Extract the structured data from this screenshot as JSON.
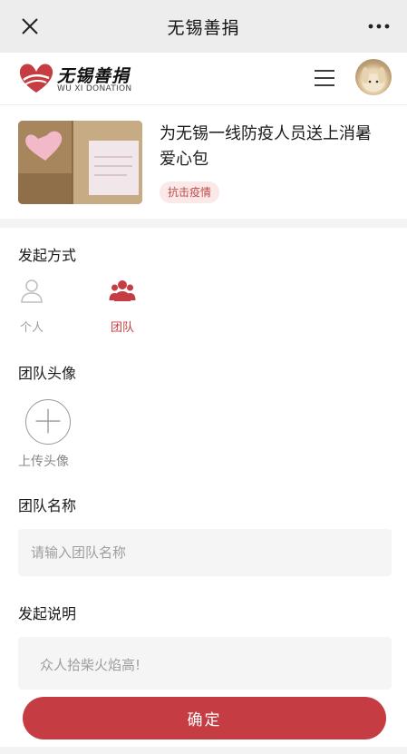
{
  "window": {
    "title": "无锡善捐",
    "close_icon": "close-icon",
    "more_icon": "more-dots-icon"
  },
  "brand": {
    "name_cn": "无锡善捐",
    "name_en": "WU XI DONATION",
    "accent": "#c53d43"
  },
  "project": {
    "title": "为无锡一线防疫人员送上消暑爱心包",
    "tag": "抗击疫情"
  },
  "initiate": {
    "label": "发起方式",
    "options": [
      {
        "label": "个人",
        "icon": "person-icon",
        "selected": false
      },
      {
        "label": "团队",
        "icon": "group-icon",
        "selected": true
      }
    ]
  },
  "team_avatar": {
    "label": "团队头像",
    "upload_label": "上传头像"
  },
  "team_name": {
    "label": "团队名称",
    "placeholder": "请输入团队名称",
    "value": ""
  },
  "description": {
    "label": "发起说明",
    "placeholder": "众人拾柴火焰高!",
    "value": ""
  },
  "confirm_label": "确定"
}
